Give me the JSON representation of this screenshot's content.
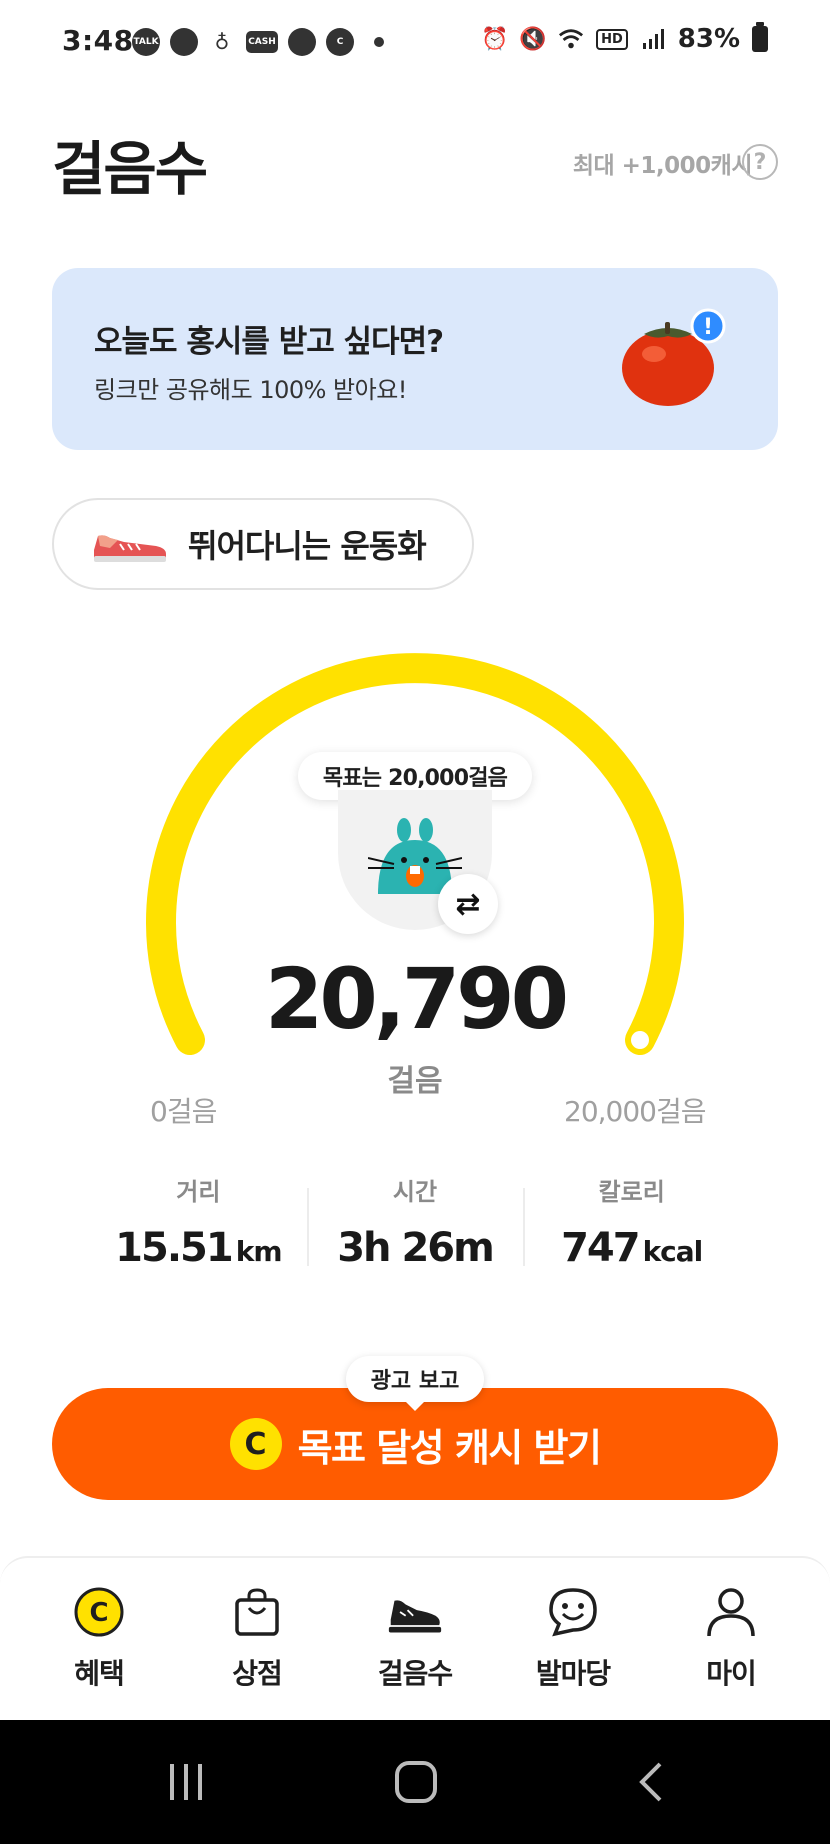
{
  "status_bar": {
    "time": "3:48",
    "left_icons": [
      "talk-icon",
      "dashboard-icon",
      "download-icon",
      "cash-icon",
      "chat-icon",
      "c-icon"
    ],
    "talk_label": "TALK",
    "cash_label": "CASH",
    "hd_label": "HD",
    "battery": "83%"
  },
  "header": {
    "title": "걸음수",
    "max_cash": "최대 +1,000캐시",
    "help": "?"
  },
  "banner": {
    "title": "오늘도 홍시를 받고 싶다면?",
    "subtitle": "링크만 공유해도 100% 받아요!",
    "badge": "!"
  },
  "shoe_chip": {
    "label": "뛰어다니는 운동화"
  },
  "gauge": {
    "goal_text": "목표는 20,000걸음",
    "steps": "20,790",
    "unit": "걸음",
    "min_label": "0걸음",
    "max_label": "20,000걸음",
    "progress": 1.0,
    "color": "#ffe100",
    "swap_icon": "⇄"
  },
  "stats": [
    {
      "label": "거리",
      "value": "15.51",
      "unit": "km"
    },
    {
      "label": "시간",
      "value": "3h 26m",
      "unit": ""
    },
    {
      "label": "칼로리",
      "value": "747",
      "unit": "kcal"
    }
  ],
  "cta": {
    "badge": "광고 보고",
    "coin": "C",
    "label": "목표 달성 캐시 받기",
    "color": "#ff5c00"
  },
  "bottom_nav": [
    {
      "label": "혜택",
      "icon": "coin-icon"
    },
    {
      "label": "상점",
      "icon": "shopping-bag-icon"
    },
    {
      "label": "걸음수",
      "icon": "sneaker-icon"
    },
    {
      "label": "발마당",
      "icon": "smile-chat-icon"
    },
    {
      "label": "마이",
      "icon": "person-icon"
    }
  ]
}
